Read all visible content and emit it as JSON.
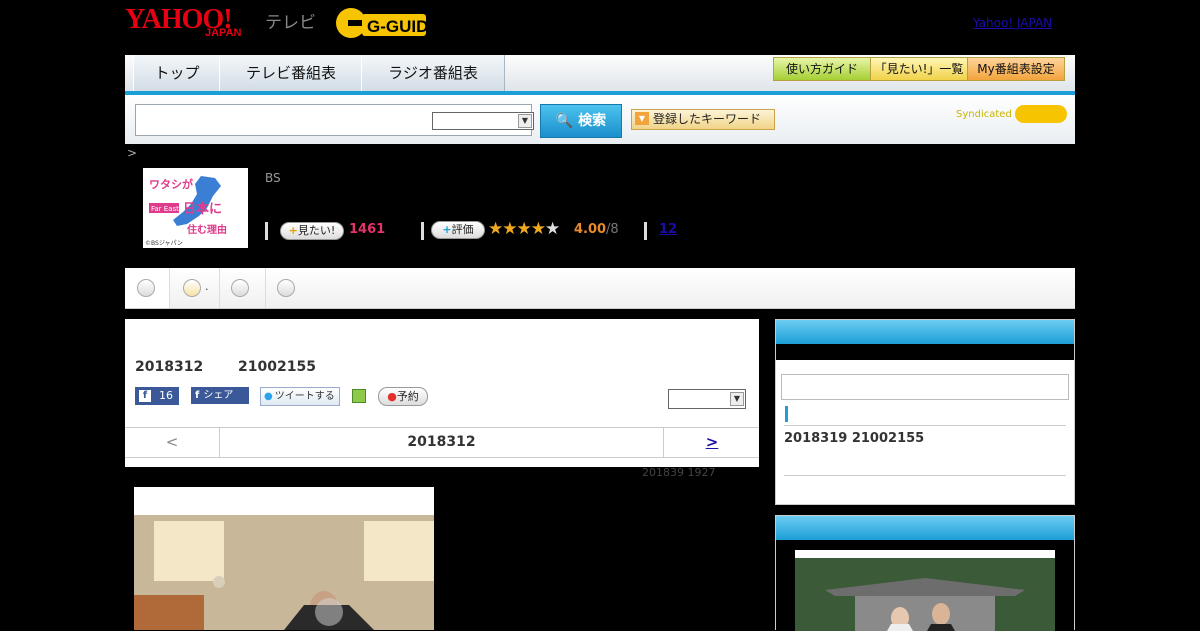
{
  "header": {
    "logo_yahoo": "YAHOO!",
    "logo_japan": "JAPAN",
    "logo_tv": "テレビ",
    "logo_gguide": "G-GUIDE",
    "yahoo_japan_link": "Yahoo! JAPAN"
  },
  "nav": {
    "tabs": [
      "トップ",
      "テレビ番組表",
      "ラジオ番組表"
    ],
    "right_buttons": [
      "使い方ガイド",
      "「見たい!」一覧",
      "My番組表設定"
    ]
  },
  "search": {
    "placeholder": "",
    "select_value": "",
    "button_label": "検索",
    "keyword_button": "登録したキーワード",
    "syndicated": "Syndicated"
  },
  "breadcrumb": ">",
  "program": {
    "thumb_lines": [
      "ワタシが",
      "日本に",
      "住む理由"
    ],
    "thumb_badge": "Far East",
    "thumb_copyright": "©BSジャパン",
    "channel": "BS",
    "watch_button": "見たい!",
    "watch_count": "1461",
    "rate_button": "評価",
    "rating": "4.00",
    "rating_total": "/8",
    "rating_stars": 4,
    "reviews": "12"
  },
  "tabs_strip": {
    "items": [
      "",
      ".",
      ""
    ]
  },
  "detail": {
    "air_date": "2018312",
    "air_time": "21002155",
    "fb_count": "16",
    "share_label": "シェア",
    "tweet_label": "ツイートする",
    "reserve_label": "予約",
    "nav_prev": "<",
    "nav_date": "2018312",
    "nav_next": ">",
    "updated": "201839  1927"
  },
  "right_panel": {
    "next_air": "2018319  21002155"
  }
}
